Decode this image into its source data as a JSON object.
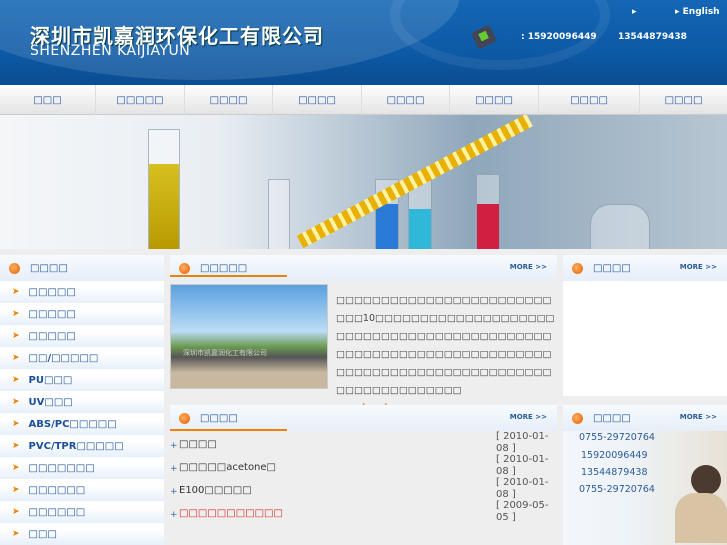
{
  "header": {
    "logo_cn": "深圳市凯嘉润环保化工有限公司",
    "logo_en": "SHENZHEN KAIJIAYUN",
    "phone1": ": 15920096449",
    "phone2": "13544879438",
    "lang_blank": "▸",
    "lang_english": "▸ English"
  },
  "nav": [
    "□□□",
    "□□□□□",
    "□□□□",
    "□□□□",
    "□□□□",
    "□□□□",
    "□□□□",
    "□□□□"
  ],
  "sidebar": {
    "title": "□□□□",
    "items": [
      "□□□□□",
      "□□□□□",
      "□□□□□",
      "□□/□□□□□",
      "PU□□□",
      "UV□□□",
      "ABS/PC□□□□□",
      "PVC/TPR□□□□□",
      "□□□□□□□",
      "□□□□□□",
      "□□□□□□",
      "□□□"
    ]
  },
  "about": {
    "title": "□□□□□",
    "more": "MORE >>",
    "photo_sign": "深圳市凯嘉润化工有限公司",
    "text": "□□□□□□□□□□□□□□□□□□□□□□□□□□□10□□□□□□□□□□□□□□□□□□□□□□□□□□□□□□□□□□□□□□□□□□□□□□□□□□□□□□□□□□□□□□□□□□□□□□□□□□□□□□□□□□□□□□□□□□□□□□□□□□□□□□□□□□",
    "ellipsis": "……",
    "detail": "[□□]"
  },
  "news": {
    "title": "□□□□",
    "more": "MORE >>",
    "items": [
      {
        "title": "□□□□",
        "date": "[ 2010-01-08 ]"
      },
      {
        "title": "□□□□□acetone□",
        "date": "[ 2010-01-08 ]"
      },
      {
        "title": "E100□□□□□",
        "date": "[ 2010-01-08 ]"
      },
      {
        "title": "□□□□□□□□□□□",
        "date": "[ 2009-05-05 ]",
        "highlight": true
      }
    ]
  },
  "right_box1": {
    "title": "□□□□",
    "more": "MORE >>"
  },
  "contact": {
    "title": "□□□□",
    "more": "MORE >>",
    "numbers": [
      "0755-29720764",
      "15920096449",
      "13544879438",
      "0755-29720764"
    ]
  }
}
